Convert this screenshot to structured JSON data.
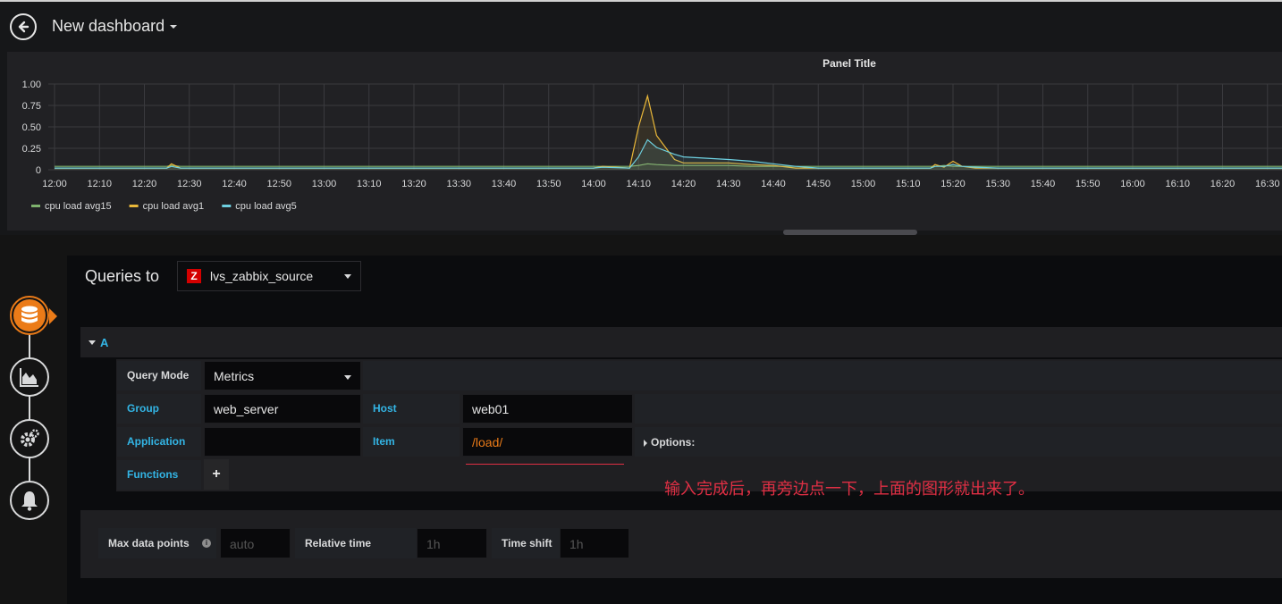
{
  "header": {
    "dashboard_title": "New dashboard"
  },
  "panel": {
    "title": "Panel Title"
  },
  "chart_data": {
    "type": "line",
    "title": "Panel Title",
    "xlabel": "",
    "ylabel": "",
    "ylim": [
      0,
      1
    ],
    "grid": true,
    "legend_position": "bottom-left",
    "y_ticks": [
      "1.00",
      "0.75",
      "0.50",
      "0.25",
      "0"
    ],
    "x_ticks": [
      "12:00",
      "12:10",
      "12:20",
      "12:30",
      "12:40",
      "12:50",
      "13:00",
      "13:10",
      "13:20",
      "13:30",
      "13:40",
      "13:50",
      "14:00",
      "14:10",
      "14:20",
      "14:30",
      "14:40",
      "14:50",
      "15:00",
      "15:10",
      "15:20",
      "15:30",
      "15:40",
      "15:50",
      "16:00",
      "16:10",
      "16:20",
      "16:30"
    ],
    "x_minutes": [
      0,
      5,
      25,
      26,
      28,
      30,
      60,
      120,
      122,
      128,
      130,
      132,
      134,
      138,
      140,
      150,
      155,
      160,
      165,
      170,
      180,
      195,
      196,
      198,
      200,
      202,
      205,
      210,
      240,
      276
    ],
    "series": [
      {
        "name": "cpu load avg15",
        "color": "#7eb26d",
        "values": [
          0.04,
          0.04,
          0.04,
          0.05,
          0.04,
          0.04,
          0.04,
          0.04,
          0.04,
          0.04,
          0.05,
          0.07,
          0.06,
          0.05,
          0.05,
          0.05,
          0.04,
          0.04,
          0.04,
          0.04,
          0.04,
          0.04,
          0.04,
          0.05,
          0.04,
          0.04,
          0.04,
          0.04,
          0.04,
          0.04
        ]
      },
      {
        "name": "cpu load avg1",
        "color": "#eab839",
        "values": [
          0.02,
          0.02,
          0.02,
          0.07,
          0.02,
          0.02,
          0.02,
          0.02,
          0.04,
          0.02,
          0.5,
          0.86,
          0.4,
          0.12,
          0.08,
          0.08,
          0.06,
          0.05,
          0.02,
          0.02,
          0.02,
          0.02,
          0.06,
          0.03,
          0.1,
          0.04,
          0.02,
          0.02,
          0.02,
          0.02
        ]
      },
      {
        "name": "cpu load avg5",
        "color": "#6ed0e0",
        "values": [
          0.02,
          0.02,
          0.02,
          0.04,
          0.02,
          0.02,
          0.02,
          0.02,
          0.03,
          0.02,
          0.15,
          0.35,
          0.26,
          0.18,
          0.15,
          0.12,
          0.1,
          0.07,
          0.04,
          0.02,
          0.02,
          0.02,
          0.04,
          0.04,
          0.06,
          0.04,
          0.03,
          0.02,
          0.02,
          0.02
        ]
      }
    ]
  },
  "editor": {
    "queries_to_label": "Queries to",
    "datasource": {
      "logo_letter": "Z",
      "name": "lvs_zabbix_source"
    },
    "query_ref": "A",
    "fields": {
      "query_mode_label": "Query Mode",
      "query_mode_value": "Metrics",
      "group_label": "Group",
      "group_value": "web_server",
      "host_label": "Host",
      "host_value": "web01",
      "application_label": "Application",
      "application_value": "",
      "item_label": "Item",
      "item_value": "/load/",
      "options_label": "Options:",
      "functions_label": "Functions",
      "functions_add": "+"
    },
    "annotation": "输入完成后，再旁边点一下，上面的图形就出来了。",
    "options": {
      "max_data_points_label": "Max data points",
      "max_data_points_placeholder": "auto",
      "relative_time_label": "Relative time",
      "relative_time_placeholder": "1h",
      "time_shift_label": "Time shift",
      "time_shift_placeholder": "1h"
    }
  },
  "sidebar": {
    "icons": [
      "queries-icon",
      "visualization-icon",
      "settings-icon",
      "alert-icon"
    ]
  }
}
